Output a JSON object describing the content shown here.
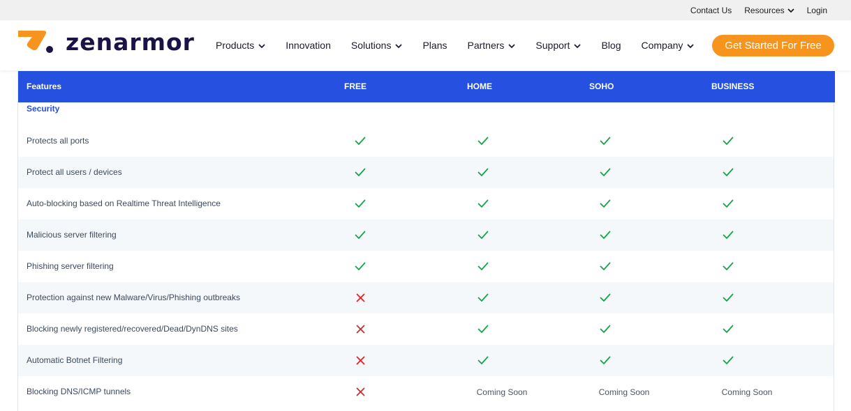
{
  "topbar": {
    "links": [
      {
        "label": "Contact Us",
        "dropdown": false
      },
      {
        "label": "Resources",
        "dropdown": true
      },
      {
        "label": "Login",
        "dropdown": false
      }
    ]
  },
  "brand": {
    "name": "zenarmor",
    "mark_color": "#f7941d",
    "text_color": "#1a1446"
  },
  "nav": {
    "items": [
      {
        "label": "Products",
        "dropdown": true
      },
      {
        "label": "Innovation",
        "dropdown": false
      },
      {
        "label": "Solutions",
        "dropdown": true
      },
      {
        "label": "Plans",
        "dropdown": false
      },
      {
        "label": "Partners",
        "dropdown": true
      },
      {
        "label": "Support",
        "dropdown": true
      },
      {
        "label": "Blog",
        "dropdown": false
      },
      {
        "label": "Company",
        "dropdown": true
      }
    ],
    "cta": "Get Started For Free"
  },
  "colors": {
    "accent": "#2650e0",
    "check": "#16a34a",
    "cross": "#e02424",
    "cta": "#f7941d"
  },
  "table": {
    "headers": [
      "Features",
      "FREE",
      "HOME",
      "SOHO",
      "BUSINESS"
    ],
    "section": "Security",
    "rows": [
      {
        "feature": "Protects all ports",
        "values": [
          "check",
          "check",
          "check",
          "check"
        ]
      },
      {
        "feature": "Protect all users / devices",
        "values": [
          "check",
          "check",
          "check",
          "check"
        ]
      },
      {
        "feature": "Auto-blocking based on Realtime Threat Intelligence",
        "values": [
          "check",
          "check",
          "check",
          "check"
        ]
      },
      {
        "feature": "Malicious server filtering",
        "values": [
          "check",
          "check",
          "check",
          "check"
        ]
      },
      {
        "feature": "Phishing server filtering",
        "values": [
          "check",
          "check",
          "check",
          "check"
        ]
      },
      {
        "feature": "Protection against new Malware/Virus/Phishing outbreaks",
        "values": [
          "cross",
          "check",
          "check",
          "check"
        ]
      },
      {
        "feature": "Blocking newly registered/recovered/Dead/DynDNS sites",
        "values": [
          "cross",
          "check",
          "check",
          "check"
        ]
      },
      {
        "feature": "Automatic Botnet Filtering",
        "values": [
          "cross",
          "check",
          "check",
          "check"
        ]
      },
      {
        "feature": "Blocking DNS/ICMP tunnels",
        "values": [
          "cross",
          "Coming Soon",
          "Coming Soon",
          "Coming Soon"
        ]
      }
    ]
  }
}
